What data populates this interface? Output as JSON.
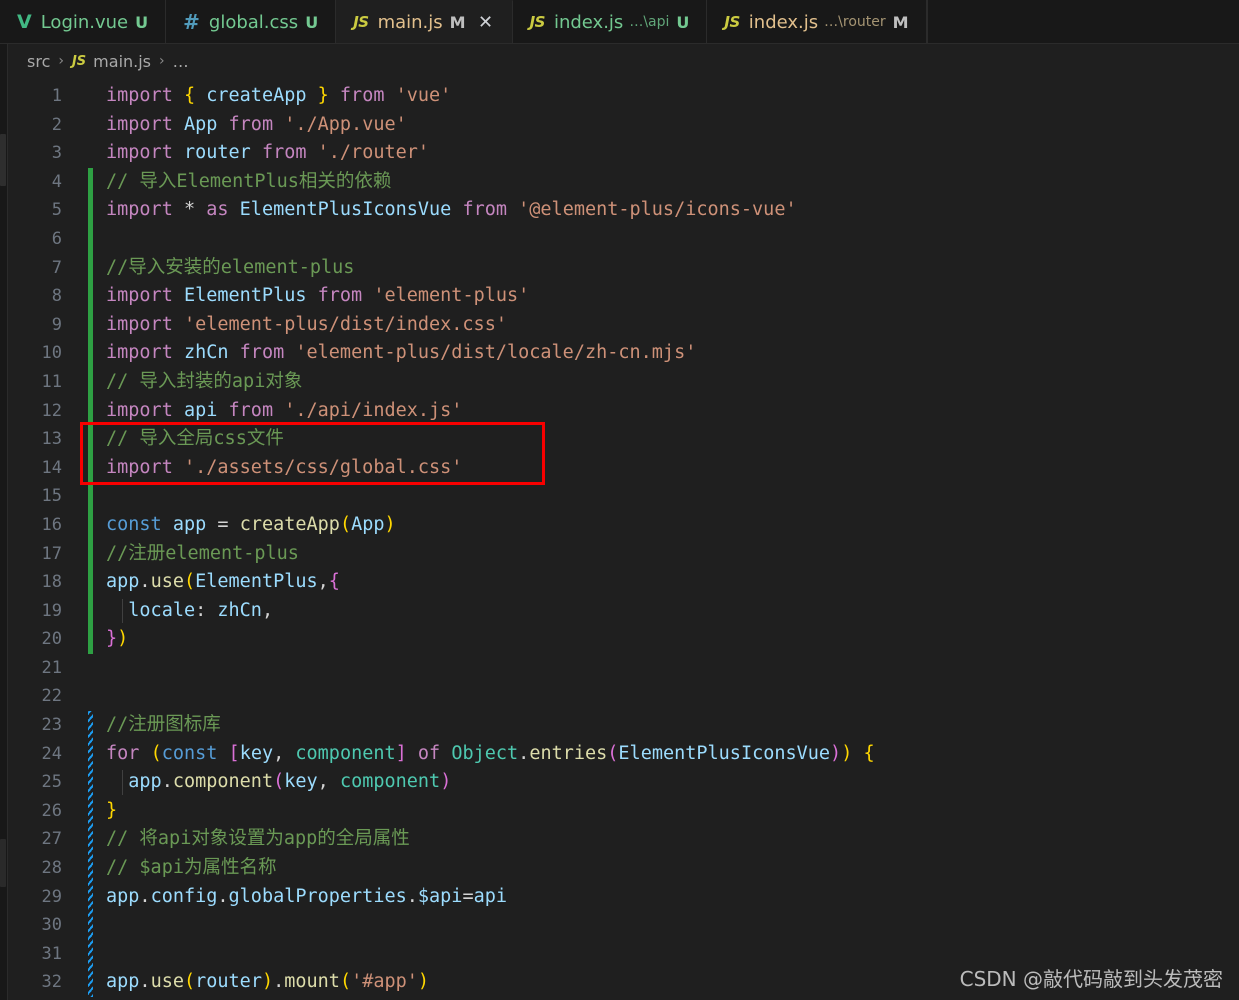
{
  "window": {
    "title": "main.js — Visual Studio Code",
    "theme": "Dark Modern",
    "colors": {
      "editor_bg": "#1f1f1f",
      "tabbar_bg": "#181818",
      "active_tab_bg": "#1f1f1f",
      "line_number": "#6e7681",
      "gutter_added": "#2ea043",
      "gutter_conflict": "#1c9cf0",
      "annotation_red": "#f70000",
      "keyword": "#c586c0",
      "keyword_const": "#569cd6",
      "variable": "#9cdcfe",
      "type": "#4ec9b0",
      "string": "#ce9178",
      "function": "#dcdcaa",
      "comment": "#6a9955",
      "bracket1": "#ffd700",
      "bracket2": "#da70d6",
      "bracket3": "#179fff"
    }
  },
  "tabs": [
    {
      "icon": "vue-icon",
      "icon_glyph": "V",
      "icon_class": "vue",
      "label": "Login.vue",
      "desc": "",
      "state": "U",
      "state_class": "u",
      "label_class": "tlabel-unsaved",
      "active": false,
      "closable": false
    },
    {
      "icon": "css-file-icon",
      "icon_glyph": "#",
      "icon_class": "css",
      "label": "global.css",
      "desc": "",
      "state": "U",
      "state_class": "u",
      "label_class": "tlabel-unsaved",
      "active": false,
      "closable": false
    },
    {
      "icon": "javascript-icon",
      "icon_glyph": "JS",
      "icon_class": "js",
      "label": "main.js",
      "desc": "",
      "state": "M",
      "state_class": "m",
      "label_class": "tlabel-modified",
      "active": true,
      "closable": true,
      "close_glyph": "✕"
    },
    {
      "icon": "javascript-icon",
      "icon_glyph": "JS",
      "icon_class": "js",
      "label": "index.js",
      "desc": "…\\api",
      "desc_class": "green",
      "state": "U",
      "state_class": "u",
      "label_class": "tlabel-unsaved",
      "active": false,
      "closable": false
    },
    {
      "icon": "javascript-icon",
      "icon_glyph": "JS",
      "icon_class": "js",
      "label": "index.js",
      "desc": "…\\router",
      "desc_class": "amber",
      "state": "M",
      "state_class": "m",
      "label_class": "tlabel-modified",
      "active": false,
      "closable": false
    }
  ],
  "breadcrumb": {
    "items": [
      "src",
      "main.js",
      "…"
    ],
    "separator": "›",
    "file_icon_glyph": "JS"
  },
  "editor": {
    "language": "javascript",
    "first_line": 1,
    "last_line": 32,
    "gutter_markers": [
      {
        "type": "added",
        "from_line": 4,
        "to_line": 20
      },
      {
        "type": "conflict",
        "from_line": 23,
        "to_line": 32
      }
    ],
    "annotation_box": {
      "label": "red-highlight-box",
      "from_line": 13,
      "to_line": 14,
      "color": "#f70000"
    },
    "lines": [
      {
        "n": 1,
        "tokens": [
          {
            "t": "import",
            "c": "t-kw"
          },
          {
            "t": " ",
            "c": "t-plain"
          },
          {
            "t": "{",
            "c": "t-p1"
          },
          {
            "t": " ",
            "c": "t-plain"
          },
          {
            "t": "createApp",
            "c": "t-var"
          },
          {
            "t": " ",
            "c": "t-plain"
          },
          {
            "t": "}",
            "c": "t-p1"
          },
          {
            "t": " ",
            "c": "t-plain"
          },
          {
            "t": "from",
            "c": "t-kw"
          },
          {
            "t": " ",
            "c": "t-plain"
          },
          {
            "t": "'vue'",
            "c": "t-str"
          }
        ]
      },
      {
        "n": 2,
        "tokens": [
          {
            "t": "import",
            "c": "t-kw"
          },
          {
            "t": " ",
            "c": "t-plain"
          },
          {
            "t": "App",
            "c": "t-var"
          },
          {
            "t": " ",
            "c": "t-plain"
          },
          {
            "t": "from",
            "c": "t-kw"
          },
          {
            "t": " ",
            "c": "t-plain"
          },
          {
            "t": "'./App.vue'",
            "c": "t-str"
          }
        ]
      },
      {
        "n": 3,
        "tokens": [
          {
            "t": "import",
            "c": "t-kw"
          },
          {
            "t": " ",
            "c": "t-plain"
          },
          {
            "t": "router",
            "c": "t-var"
          },
          {
            "t": " ",
            "c": "t-plain"
          },
          {
            "t": "from",
            "c": "t-kw"
          },
          {
            "t": " ",
            "c": "t-plain"
          },
          {
            "t": "'./router'",
            "c": "t-str"
          }
        ]
      },
      {
        "n": 4,
        "tokens": [
          {
            "t": "// 导入ElementPlus相关的依赖",
            "c": "t-cmt"
          }
        ]
      },
      {
        "n": 5,
        "tokens": [
          {
            "t": "import",
            "c": "t-kw"
          },
          {
            "t": " ",
            "c": "t-plain"
          },
          {
            "t": "*",
            "c": "t-op"
          },
          {
            "t": " ",
            "c": "t-plain"
          },
          {
            "t": "as",
            "c": "t-kw"
          },
          {
            "t": " ",
            "c": "t-plain"
          },
          {
            "t": "ElementPlusIconsVue",
            "c": "t-var"
          },
          {
            "t": " ",
            "c": "t-plain"
          },
          {
            "t": "from",
            "c": "t-kw"
          },
          {
            "t": " ",
            "c": "t-plain"
          },
          {
            "t": "'@element-plus/icons-vue'",
            "c": "t-str"
          }
        ]
      },
      {
        "n": 6,
        "tokens": []
      },
      {
        "n": 7,
        "tokens": [
          {
            "t": "//导入安装的element-plus",
            "c": "t-cmt"
          }
        ]
      },
      {
        "n": 8,
        "tokens": [
          {
            "t": "import",
            "c": "t-kw"
          },
          {
            "t": " ",
            "c": "t-plain"
          },
          {
            "t": "ElementPlus",
            "c": "t-var"
          },
          {
            "t": " ",
            "c": "t-plain"
          },
          {
            "t": "from",
            "c": "t-kw"
          },
          {
            "t": " ",
            "c": "t-plain"
          },
          {
            "t": "'element-plus'",
            "c": "t-str"
          }
        ]
      },
      {
        "n": 9,
        "tokens": [
          {
            "t": "import",
            "c": "t-kw"
          },
          {
            "t": " ",
            "c": "t-plain"
          },
          {
            "t": "'element-plus/dist/index.css'",
            "c": "t-str"
          }
        ]
      },
      {
        "n": 10,
        "tokens": [
          {
            "t": "import",
            "c": "t-kw"
          },
          {
            "t": " ",
            "c": "t-plain"
          },
          {
            "t": "zhCn",
            "c": "t-var"
          },
          {
            "t": " ",
            "c": "t-plain"
          },
          {
            "t": "from",
            "c": "t-kw"
          },
          {
            "t": " ",
            "c": "t-plain"
          },
          {
            "t": "'element-plus/dist/locale/zh-cn.mjs'",
            "c": "t-str"
          }
        ]
      },
      {
        "n": 11,
        "tokens": [
          {
            "t": "// 导入封装的api对象",
            "c": "t-cmt"
          }
        ]
      },
      {
        "n": 12,
        "tokens": [
          {
            "t": "import",
            "c": "t-kw"
          },
          {
            "t": " ",
            "c": "t-plain"
          },
          {
            "t": "api",
            "c": "t-var"
          },
          {
            "t": " ",
            "c": "t-plain"
          },
          {
            "t": "from",
            "c": "t-kw"
          },
          {
            "t": " ",
            "c": "t-plain"
          },
          {
            "t": "'./api/index.js'",
            "c": "t-str"
          }
        ]
      },
      {
        "n": 13,
        "tokens": [
          {
            "t": "// 导入全局css文件",
            "c": "t-cmt"
          }
        ]
      },
      {
        "n": 14,
        "tokens": [
          {
            "t": "import",
            "c": "t-kw"
          },
          {
            "t": " ",
            "c": "t-plain"
          },
          {
            "t": "'./assets/css/global.css'",
            "c": "t-str"
          }
        ]
      },
      {
        "n": 15,
        "tokens": []
      },
      {
        "n": 16,
        "tokens": [
          {
            "t": "const",
            "c": "t-kw2"
          },
          {
            "t": " ",
            "c": "t-plain"
          },
          {
            "t": "app",
            "c": "t-var"
          },
          {
            "t": " ",
            "c": "t-plain"
          },
          {
            "t": "=",
            "c": "t-op"
          },
          {
            "t": " ",
            "c": "t-plain"
          },
          {
            "t": "createApp",
            "c": "t-fn"
          },
          {
            "t": "(",
            "c": "t-p1"
          },
          {
            "t": "App",
            "c": "t-var"
          },
          {
            "t": ")",
            "c": "t-p1"
          }
        ]
      },
      {
        "n": 17,
        "tokens": [
          {
            "t": "//注册element-plus",
            "c": "t-cmt"
          }
        ]
      },
      {
        "n": 18,
        "tokens": [
          {
            "t": "app",
            "c": "t-var"
          },
          {
            "t": ".",
            "c": "t-op"
          },
          {
            "t": "use",
            "c": "t-fn"
          },
          {
            "t": "(",
            "c": "t-p1"
          },
          {
            "t": "ElementPlus",
            "c": "t-var"
          },
          {
            "t": ",",
            "c": "t-op"
          },
          {
            "t": "{",
            "c": "t-p2"
          }
        ]
      },
      {
        "n": 19,
        "tokens": [
          {
            "t": "  ",
            "c": "t-plain"
          },
          {
            "t": "locale",
            "c": "t-var"
          },
          {
            "t": ":",
            "c": "t-op"
          },
          {
            "t": " ",
            "c": "t-plain"
          },
          {
            "t": "zhCn",
            "c": "t-var"
          },
          {
            "t": ",",
            "c": "t-op"
          }
        ]
      },
      {
        "n": 20,
        "tokens": [
          {
            "t": "}",
            "c": "t-p2"
          },
          {
            "t": ")",
            "c": "t-p1"
          }
        ]
      },
      {
        "n": 21,
        "tokens": []
      },
      {
        "n": 22,
        "tokens": []
      },
      {
        "n": 23,
        "tokens": [
          {
            "t": "//注册图标库",
            "c": "t-cmt"
          }
        ]
      },
      {
        "n": 24,
        "tokens": [
          {
            "t": "for",
            "c": "t-kw"
          },
          {
            "t": " ",
            "c": "t-plain"
          },
          {
            "t": "(",
            "c": "t-p1"
          },
          {
            "t": "const",
            "c": "t-kw2"
          },
          {
            "t": " ",
            "c": "t-plain"
          },
          {
            "t": "[",
            "c": "t-p2"
          },
          {
            "t": "key",
            "c": "t-var"
          },
          {
            "t": ",",
            "c": "t-op"
          },
          {
            "t": " ",
            "c": "t-plain"
          },
          {
            "t": "component",
            "c": "t-type"
          },
          {
            "t": "]",
            "c": "t-p2"
          },
          {
            "t": " ",
            "c": "t-plain"
          },
          {
            "t": "of",
            "c": "t-kw"
          },
          {
            "t": " ",
            "c": "t-plain"
          },
          {
            "t": "Object",
            "c": "t-type"
          },
          {
            "t": ".",
            "c": "t-op"
          },
          {
            "t": "entries",
            "c": "t-fn"
          },
          {
            "t": "(",
            "c": "t-p2"
          },
          {
            "t": "ElementPlusIconsVue",
            "c": "t-var"
          },
          {
            "t": ")",
            "c": "t-p2"
          },
          {
            "t": ")",
            "c": "t-p1"
          },
          {
            "t": " ",
            "c": "t-plain"
          },
          {
            "t": "{",
            "c": "t-p1"
          }
        ]
      },
      {
        "n": 25,
        "tokens": [
          {
            "t": "  ",
            "c": "t-plain"
          },
          {
            "t": "app",
            "c": "t-var"
          },
          {
            "t": ".",
            "c": "t-op"
          },
          {
            "t": "component",
            "c": "t-fn"
          },
          {
            "t": "(",
            "c": "t-p2"
          },
          {
            "t": "key",
            "c": "t-var"
          },
          {
            "t": ",",
            "c": "t-op"
          },
          {
            "t": " ",
            "c": "t-plain"
          },
          {
            "t": "component",
            "c": "t-type"
          },
          {
            "t": ")",
            "c": "t-p2"
          }
        ]
      },
      {
        "n": 26,
        "tokens": [
          {
            "t": "}",
            "c": "t-p1"
          }
        ]
      },
      {
        "n": 27,
        "tokens": [
          {
            "t": "// 将api对象设置为app的全局属性",
            "c": "t-cmt"
          }
        ]
      },
      {
        "n": 28,
        "tokens": [
          {
            "t": "// $api为属性名称",
            "c": "t-cmt"
          }
        ]
      },
      {
        "n": 29,
        "tokens": [
          {
            "t": "app",
            "c": "t-var"
          },
          {
            "t": ".",
            "c": "t-op"
          },
          {
            "t": "config",
            "c": "t-var"
          },
          {
            "t": ".",
            "c": "t-op"
          },
          {
            "t": "globalProperties",
            "c": "t-var"
          },
          {
            "t": ".",
            "c": "t-op"
          },
          {
            "t": "$api",
            "c": "t-var"
          },
          {
            "t": "=",
            "c": "t-op"
          },
          {
            "t": "api",
            "c": "t-var"
          }
        ]
      },
      {
        "n": 30,
        "tokens": []
      },
      {
        "n": 31,
        "tokens": []
      },
      {
        "n": 32,
        "tokens": [
          {
            "t": "app",
            "c": "t-var"
          },
          {
            "t": ".",
            "c": "t-op"
          },
          {
            "t": "use",
            "c": "t-fn"
          },
          {
            "t": "(",
            "c": "t-p1"
          },
          {
            "t": "router",
            "c": "t-var"
          },
          {
            "t": ")",
            "c": "t-p1"
          },
          {
            "t": ".",
            "c": "t-op"
          },
          {
            "t": "mount",
            "c": "t-fn"
          },
          {
            "t": "(",
            "c": "t-p1"
          },
          {
            "t": "'#app'",
            "c": "t-str"
          },
          {
            "t": ")",
            "c": "t-p1"
          }
        ]
      }
    ]
  },
  "watermark": {
    "text": "CSDN @敲代码敲到头发茂密"
  }
}
